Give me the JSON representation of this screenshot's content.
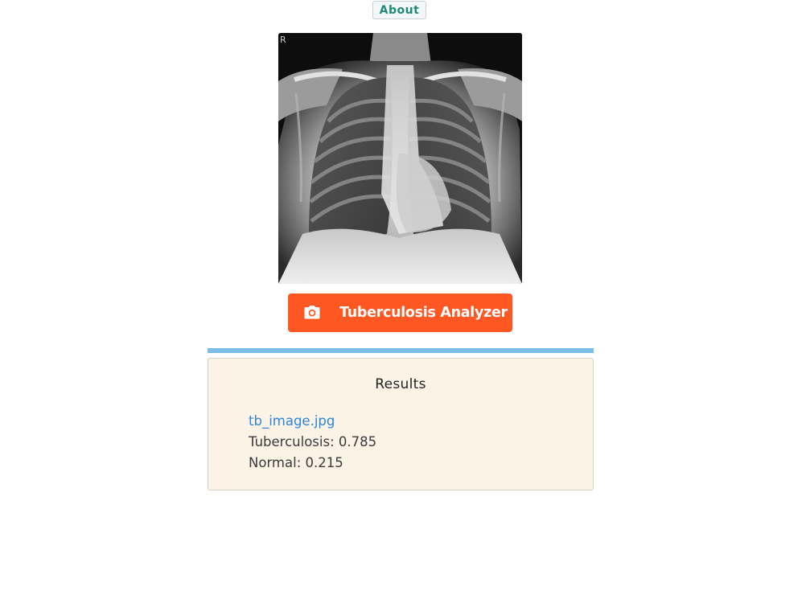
{
  "header": {
    "about_label": "About"
  },
  "xray": {
    "marker": "R"
  },
  "analyzer": {
    "button_label": "Tuberculosis Analyzer",
    "icon": "camera-icon",
    "color": "#ff5722"
  },
  "progress": {
    "value": 1.0,
    "color": "#7bbde6"
  },
  "results": {
    "title": "Results",
    "filename": "tb_image.jpg",
    "items": [
      {
        "text": "Tuberculosis: 0.785"
      },
      {
        "text": "Normal: 0.215"
      }
    ]
  }
}
